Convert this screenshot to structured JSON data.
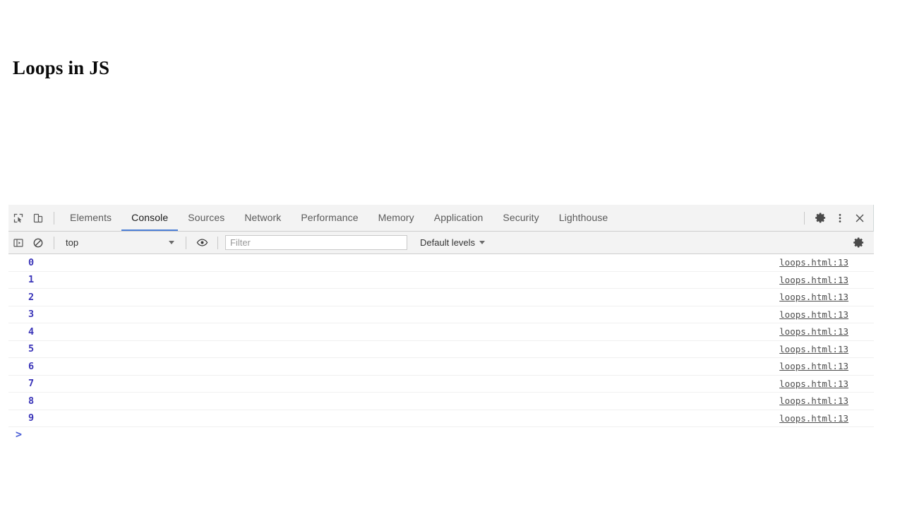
{
  "page": {
    "heading": "Loops in JS"
  },
  "devtools": {
    "toolbar": {
      "inspect_icon": "inspect-element-icon",
      "device_icon": "device-toolbar-icon",
      "tabs": [
        {
          "label": "Elements",
          "selected": false
        },
        {
          "label": "Console",
          "selected": true
        },
        {
          "label": "Sources",
          "selected": false
        },
        {
          "label": "Network",
          "selected": false
        },
        {
          "label": "Performance",
          "selected": false
        },
        {
          "label": "Memory",
          "selected": false
        },
        {
          "label": "Application",
          "selected": false
        },
        {
          "label": "Security",
          "selected": false
        },
        {
          "label": "Lighthouse",
          "selected": false
        }
      ],
      "settings_icon": "gear-icon",
      "more_icon": "kebab-menu-icon",
      "close_icon": "close-icon"
    },
    "filterbar": {
      "sidebar_icon": "console-sidebar-toggle-icon",
      "clear_icon": "clear-console-icon",
      "context_value": "top",
      "eye_icon": "live-expression-eye-icon",
      "filter_placeholder": "Filter",
      "filter_value": "",
      "levels_value": "Default levels",
      "settings_icon": "console-settings-gear-icon"
    },
    "console": {
      "messages": [
        {
          "value": "0",
          "source": "loops.html:13"
        },
        {
          "value": "1",
          "source": "loops.html:13"
        },
        {
          "value": "2",
          "source": "loops.html:13"
        },
        {
          "value": "3",
          "source": "loops.html:13"
        },
        {
          "value": "4",
          "source": "loops.html:13"
        },
        {
          "value": "5",
          "source": "loops.html:13"
        },
        {
          "value": "6",
          "source": "loops.html:13"
        },
        {
          "value": "7",
          "source": "loops.html:13"
        },
        {
          "value": "8",
          "source": "loops.html:13"
        },
        {
          "value": "9",
          "source": "loops.html:13"
        }
      ],
      "prompt_symbol": ">",
      "prompt_value": ""
    }
  },
  "colors": {
    "accent": "#4b7fd6",
    "number_literal": "#3a34b8",
    "toolbar_bg": "#f3f3f3",
    "border": "#cdcdcd"
  }
}
